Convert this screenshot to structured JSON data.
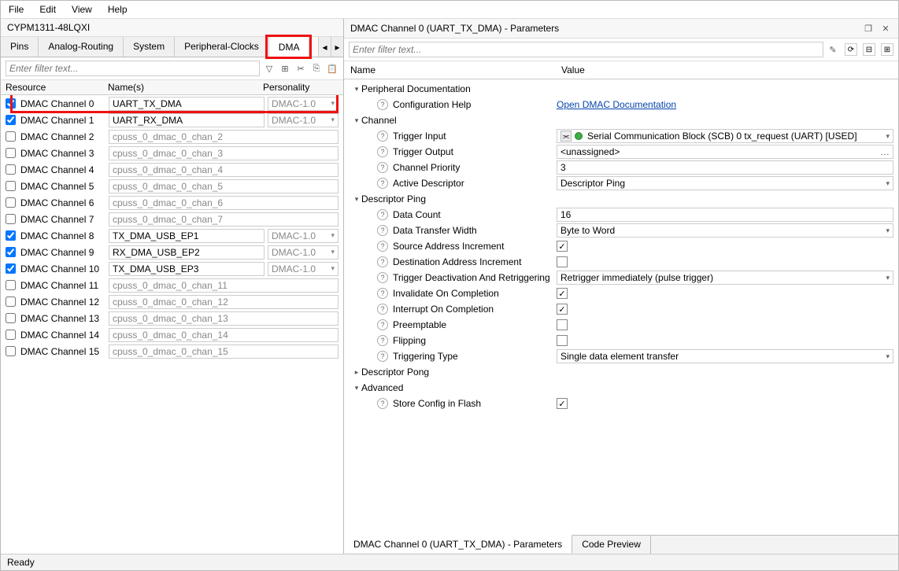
{
  "menu": {
    "file": "File",
    "edit": "Edit",
    "view": "View",
    "help": "Help"
  },
  "left": {
    "device_title": "CYPM1311-48LQXI",
    "tabs": [
      "Pins",
      "Analog-Routing",
      "System",
      "Peripheral-Clocks",
      "DMA"
    ],
    "active_tab": 4,
    "filter_placeholder": "Enter filter text...",
    "col_resource": "Resource",
    "col_names": "Name(s)",
    "col_personality": "Personality",
    "rows": [
      {
        "checked": true,
        "label": "DMAC Channel 0",
        "name": "UART_TX_DMA",
        "personality": "DMAC-1.0"
      },
      {
        "checked": true,
        "label": "DMAC Channel 1",
        "name": "UART_RX_DMA",
        "personality": "DMAC-1.0"
      },
      {
        "checked": false,
        "label": "DMAC Channel 2",
        "name": "cpuss_0_dmac_0_chan_2",
        "personality": ""
      },
      {
        "checked": false,
        "label": "DMAC Channel 3",
        "name": "cpuss_0_dmac_0_chan_3",
        "personality": ""
      },
      {
        "checked": false,
        "label": "DMAC Channel 4",
        "name": "cpuss_0_dmac_0_chan_4",
        "personality": ""
      },
      {
        "checked": false,
        "label": "DMAC Channel 5",
        "name": "cpuss_0_dmac_0_chan_5",
        "personality": ""
      },
      {
        "checked": false,
        "label": "DMAC Channel 6",
        "name": "cpuss_0_dmac_0_chan_6",
        "personality": ""
      },
      {
        "checked": false,
        "label": "DMAC Channel 7",
        "name": "cpuss_0_dmac_0_chan_7",
        "personality": ""
      },
      {
        "checked": true,
        "label": "DMAC Channel 8",
        "name": "TX_DMA_USB_EP1",
        "personality": "DMAC-1.0"
      },
      {
        "checked": true,
        "label": "DMAC Channel 9",
        "name": "RX_DMA_USB_EP2",
        "personality": "DMAC-1.0"
      },
      {
        "checked": true,
        "label": "DMAC Channel 10",
        "name": "TX_DMA_USB_EP3",
        "personality": "DMAC-1.0"
      },
      {
        "checked": false,
        "label": "DMAC Channel 11",
        "name": "cpuss_0_dmac_0_chan_11",
        "personality": ""
      },
      {
        "checked": false,
        "label": "DMAC Channel 12",
        "name": "cpuss_0_dmac_0_chan_12",
        "personality": ""
      },
      {
        "checked": false,
        "label": "DMAC Channel 13",
        "name": "cpuss_0_dmac_0_chan_13",
        "personality": ""
      },
      {
        "checked": false,
        "label": "DMAC Channel 14",
        "name": "cpuss_0_dmac_0_chan_14",
        "personality": ""
      },
      {
        "checked": false,
        "label": "DMAC Channel 15",
        "name": "cpuss_0_dmac_0_chan_15",
        "personality": ""
      }
    ]
  },
  "right": {
    "panel_title": "DMAC Channel 0 (UART_TX_DMA) - Parameters",
    "filter_placeholder": "Enter filter text...",
    "col_name": "Name",
    "col_value": "Value",
    "groups": {
      "pdoc": "Peripheral Documentation",
      "channel": "Channel",
      "dping": "Descriptor Ping",
      "dpong": "Descriptor Pong",
      "adv": "Advanced"
    },
    "params": {
      "cfg_help": "Configuration Help",
      "cfg_help_link": "Open DMAC Documentation",
      "trig_in": "Trigger Input",
      "trig_in_val": "Serial Communication Block (SCB) 0 tx_request (UART) [USED]",
      "trig_out": "Trigger Output",
      "trig_out_val": "<unassigned>",
      "chan_prio": "Channel Priority",
      "chan_prio_val": "3",
      "active_desc": "Active Descriptor",
      "active_desc_val": "Descriptor Ping",
      "data_count": "Data Count",
      "data_count_val": "16",
      "dtw": "Data Transfer Width",
      "dtw_val": "Byte to Word",
      "src_inc": "Source Address Increment",
      "dst_inc": "Destination Address Increment",
      "trig_deact": "Trigger Deactivation And Retriggering",
      "trig_deact_val": "Retrigger immediately (pulse trigger)",
      "inv_comp": "Invalidate On Completion",
      "int_comp": "Interrupt On Completion",
      "preempt": "Preemptable",
      "flipping": "Flipping",
      "trig_type": "Triggering Type",
      "trig_type_val": "Single data element transfer",
      "store_flash": "Store Config in Flash"
    },
    "checks": {
      "src_inc": true,
      "dst_inc": false,
      "inv_comp": true,
      "int_comp": true,
      "preempt": false,
      "flipping": false,
      "store_flash": true
    },
    "bottom_tabs": {
      "params": "DMAC Channel 0 (UART_TX_DMA) - Parameters",
      "code": "Code Preview"
    }
  },
  "status": "Ready"
}
